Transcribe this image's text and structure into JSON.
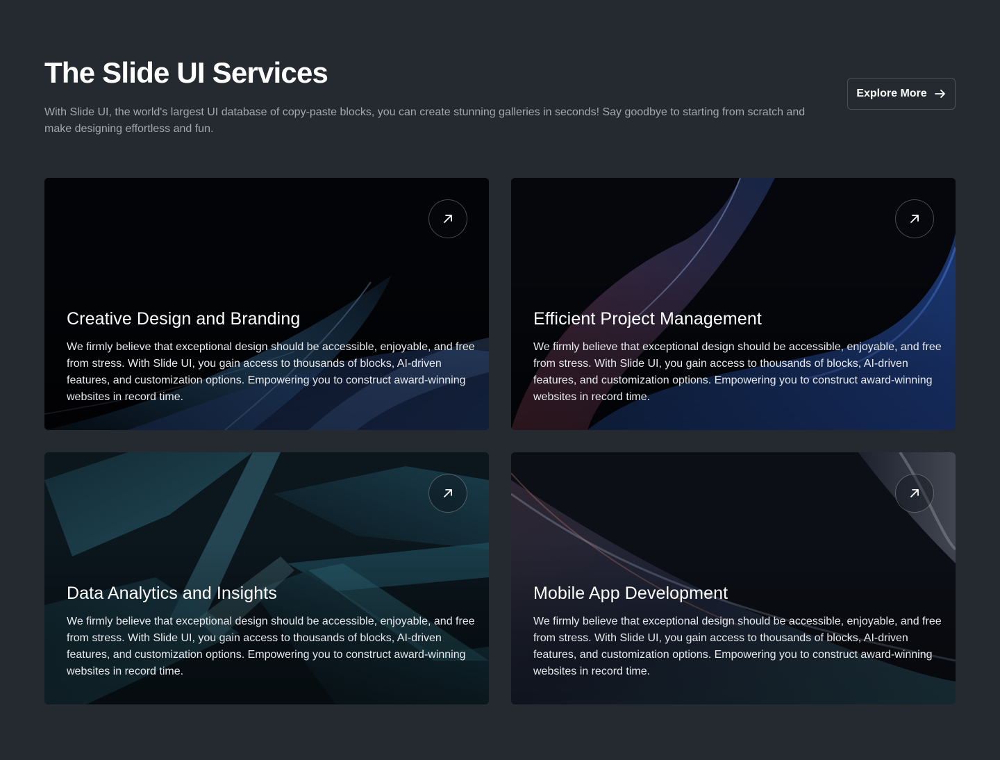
{
  "header": {
    "title": "The Slide UI Services",
    "subtitle": "With Slide UI, the world's largest UI database of copy-paste blocks, you can create stunning galleries in seconds! Say goodbye to starting from scratch and make designing effortless and fun.",
    "explore_label": "Explore More"
  },
  "cards": [
    {
      "title": "Creative Design and Branding",
      "text": "We firmly believe that exceptional design should be accessible, enjoyable, and free from stress. With Slide UI, you gain access to thousands of blocks, AI-driven features, and customization options. Empowering you to construct award-winning websites in record time."
    },
    {
      "title": "Efficient Project Management",
      "text": "We firmly believe that exceptional design should be accessible, enjoyable, and free from stress. With Slide UI, you gain access to thousands of blocks, AI-driven features, and customization options. Empowering you to construct award-winning websites in record time."
    },
    {
      "title": "Data Analytics and Insights",
      "text": "We firmly believe that exceptional design should be accessible, enjoyable, and free from stress. With Slide UI, you gain access to thousands of blocks, AI-driven features, and customization options. Empowering you to construct award-winning websites in record time."
    },
    {
      "title": "Mobile App Development",
      "text": "We firmly believe that exceptional design should be accessible, enjoyable, and free from stress. With Slide UI, you gain access to thousands of blocks, AI-driven features, and customization options. Empowering you to construct award-winning websites in record time."
    }
  ],
  "icons": {
    "explore_button": "arrow-right-icon",
    "card_button": "arrow-up-right-icon"
  },
  "colors": {
    "background": "#252a31",
    "card_base": "#05060a",
    "text_primary": "#ffffff",
    "text_muted": "#a3a8b0"
  }
}
